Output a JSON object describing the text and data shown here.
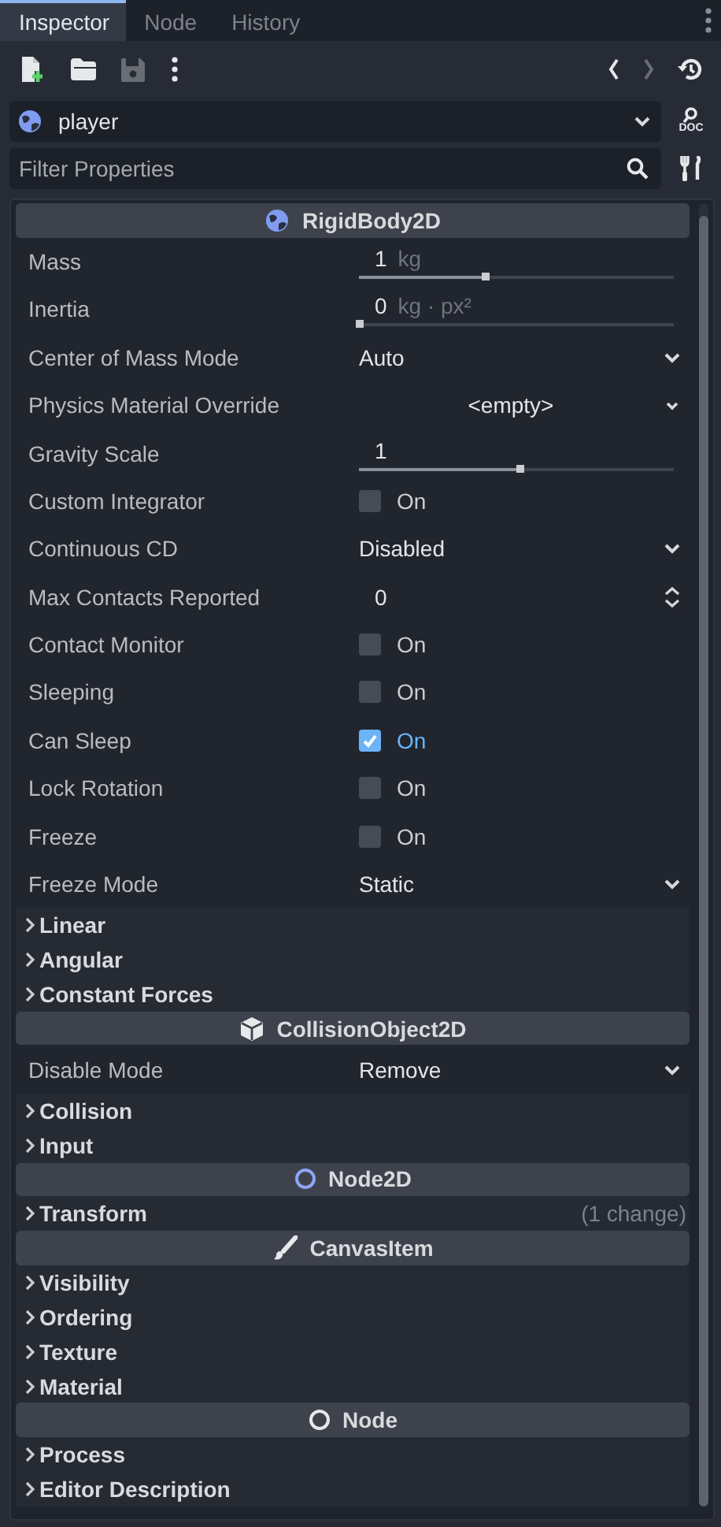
{
  "tabs": [
    {
      "label": "Inspector",
      "selected": true
    },
    {
      "label": "Node",
      "selected": false
    },
    {
      "label": "History",
      "selected": false
    }
  ],
  "toolbar_buttons": [
    {
      "disabled": false
    },
    {
      "disabled": false
    },
    {
      "disabled": true
    },
    {
      "disabled": false
    }
  ],
  "history_buttons": [
    {
      "disabled": false
    },
    {
      "disabled": true
    },
    {
      "disabled": false
    }
  ],
  "object_picker": {
    "value": "player"
  },
  "doc_button": {
    "label": "DOC"
  },
  "filter": {
    "placeholder": "Filter Properties"
  },
  "sections": [
    {
      "title": "RigidBody2D",
      "properties": [
        {
          "kind": "slider",
          "label": "Mass",
          "value": "1",
          "unit": "kg",
          "level": 0.4
        },
        {
          "kind": "slider",
          "label": "Inertia",
          "value": "0",
          "unit": "kg · px²",
          "level": 0
        },
        {
          "kind": "enum",
          "label": "Center of Mass Mode",
          "value": "Auto"
        },
        {
          "kind": "resource",
          "label": "Physics Material Override",
          "value": "<empty>"
        },
        {
          "kind": "slider",
          "label": "Gravity Scale",
          "value": "1",
          "level": 0.51
        },
        {
          "kind": "check",
          "label": "Custom Integrator",
          "text": "On",
          "checked": false
        },
        {
          "kind": "enum",
          "label": "Continuous CD",
          "value": "Disabled"
        },
        {
          "kind": "spin",
          "label": "Max Contacts Reported",
          "value": "0"
        },
        {
          "kind": "check",
          "label": "Contact Monitor",
          "text": "On",
          "checked": false
        },
        {
          "kind": "check",
          "label": "Sleeping",
          "text": "On",
          "checked": false
        },
        {
          "kind": "check",
          "label": "Can Sleep",
          "text": "On",
          "checked": true
        },
        {
          "kind": "check",
          "label": "Lock Rotation",
          "text": "On",
          "checked": false
        },
        {
          "kind": "check",
          "label": "Freeze",
          "text": "On",
          "checked": false
        },
        {
          "kind": "enum",
          "label": "Freeze Mode",
          "value": "Static"
        },
        {
          "kind": "group",
          "label": "Linear",
          "expanded": false
        },
        {
          "kind": "group",
          "label": "Angular",
          "expanded": false
        },
        {
          "kind": "group",
          "label": "Constant Forces",
          "expanded": false
        }
      ]
    },
    {
      "title": "CollisionObject2D",
      "properties": [
        {
          "kind": "enum",
          "label": "Disable Mode",
          "value": "Remove"
        },
        {
          "kind": "group",
          "label": "Collision",
          "expanded": false
        },
        {
          "kind": "group",
          "label": "Input",
          "expanded": false
        }
      ]
    },
    {
      "title": "Node2D",
      "properties": [
        {
          "kind": "group",
          "label": "Transform",
          "expanded": false,
          "note": "(1 change)"
        }
      ]
    },
    {
      "title": "CanvasItem",
      "properties": [
        {
          "kind": "group",
          "label": "Visibility",
          "expanded": false
        },
        {
          "kind": "group",
          "label": "Ordering",
          "expanded": false
        },
        {
          "kind": "group",
          "label": "Texture",
          "expanded": false
        },
        {
          "kind": "group",
          "label": "Material",
          "expanded": false
        }
      ]
    },
    {
      "title": "Node",
      "properties": [
        {
          "kind": "group",
          "label": "Process",
          "expanded": false
        },
        {
          "kind": "group",
          "label": "Editor Description",
          "expanded": false
        }
      ]
    }
  ]
}
